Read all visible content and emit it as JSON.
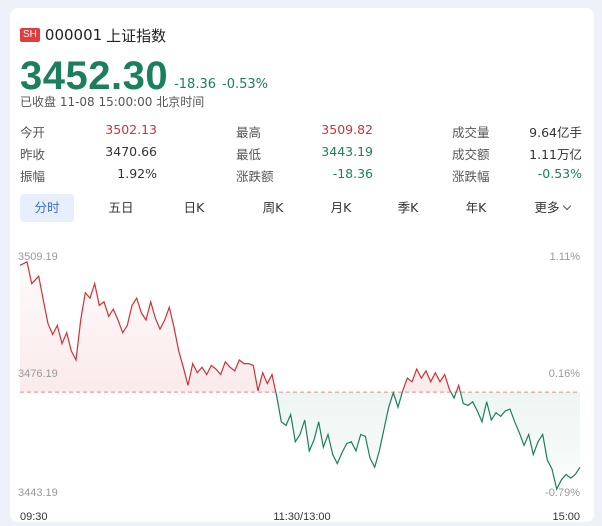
{
  "header": {
    "badge": "SH",
    "code": "000001",
    "name": "上证指数",
    "price": "3452.30",
    "change": "-18.36",
    "change_pct": "-0.53%",
    "status": "已收盘 11-08 15:00:00 北京时间"
  },
  "stats": [
    [
      {
        "label": "今开",
        "value": "3502.13",
        "tone": "red"
      },
      {
        "label": "最高",
        "value": "3509.82",
        "tone": "red"
      },
      {
        "label": "成交量",
        "value": "9.64亿手",
        "tone": "dark"
      }
    ],
    [
      {
        "label": "昨收",
        "value": "3470.66",
        "tone": "dark"
      },
      {
        "label": "最低",
        "value": "3443.19",
        "tone": "green"
      },
      {
        "label": "成交额",
        "value": "1.11万亿",
        "tone": "dark"
      }
    ],
    [
      {
        "label": "振幅",
        "value": "1.92%",
        "tone": "dark"
      },
      {
        "label": "涨跌额",
        "value": "-18.36",
        "tone": "green"
      },
      {
        "label": "涨跌幅",
        "value": "-0.53%",
        "tone": "green"
      }
    ]
  ],
  "tabs": [
    "分时",
    "五日",
    "日K",
    "周K",
    "月K",
    "季K",
    "年K",
    "更多"
  ],
  "active_tab": "分时",
  "colors": {
    "up": "#d0303a",
    "down": "#1b7f5b",
    "accent": "#3a6fd8",
    "prev_close_line": "#e88a8a"
  },
  "chart_data": {
    "type": "line",
    "y_left_ticks": [
      "3509.19",
      "3476.19",
      "3443.19"
    ],
    "y_right_ticks": [
      "1.11%",
      "0.16%",
      "-0.79%"
    ],
    "x_ticks": [
      "09:30",
      "11:30/13:00",
      "15:00"
    ],
    "ylim": [
      3443.19,
      3509.19
    ],
    "prev_close": 3470.66,
    "grid": false,
    "x": [
      0,
      3,
      5,
      8,
      10,
      12,
      14,
      16,
      18,
      20,
      22,
      24,
      26,
      28,
      30,
      32,
      34,
      36,
      38,
      40,
      42,
      44,
      46,
      48,
      50,
      52,
      54,
      56,
      58,
      60,
      62,
      64,
      66,
      68,
      70,
      72,
      74,
      76,
      78,
      80,
      82,
      84,
      86,
      88,
      90,
      92,
      94,
      96,
      98,
      100,
      102,
      104,
      106,
      108,
      110,
      112,
      114,
      116,
      118,
      120,
      122,
      124,
      126,
      128,
      130,
      132,
      134,
      136,
      138,
      140,
      142,
      144,
      146,
      148,
      150,
      152,
      154,
      156,
      158,
      160,
      162,
      164,
      166,
      168,
      170,
      172,
      174,
      176,
      178,
      180,
      182,
      184,
      186,
      188,
      190,
      192,
      194,
      196,
      198,
      200,
      202,
      204,
      206,
      208,
      210,
      212,
      214,
      216,
      218,
      220,
      222,
      224,
      226,
      228,
      230,
      232,
      234,
      236,
      238,
      240
    ],
    "values": [
      3505.5,
      3506.5,
      3500.5,
      3502.5,
      3496.0,
      3489.5,
      3486.5,
      3489.0,
      3484.0,
      3487.0,
      3482.0,
      3479.5,
      3490.5,
      3498.0,
      3496.5,
      3500.5,
      3494.5,
      3495.5,
      3491.5,
      3493.5,
      3490.5,
      3487.0,
      3489.0,
      3494.5,
      3496.5,
      3492.5,
      3490.5,
      3495.5,
      3491.0,
      3488.0,
      3490.5,
      3494.0,
      3488.5,
      3482.0,
      3477.5,
      3472.5,
      3478.5,
      3476.0,
      3477.5,
      3475.5,
      3478.0,
      3477.0,
      3475.5,
      3479.0,
      3477.5,
      3476.5,
      3479.5,
      3478.5,
      3478.5,
      3478.0,
      3471.0,
      3476.0,
      3473.0,
      3475.5,
      3469.5,
      3462.5,
      3461.5,
      3464.5,
      3457.0,
      3459.0,
      3463.0,
      3454.5,
      3457.5,
      3462.5,
      3455.5,
      3459.0,
      3453.5,
      3451.0,
      3454.0,
      3456.5,
      3457.0,
      3454.5,
      3459.0,
      3458.5,
      3452.5,
      3450.0,
      3454.5,
      3460.5,
      3466.5,
      3470.5,
      3466.5,
      3471.0,
      3474.5,
      3473.5,
      3477.0,
      3474.5,
      3476.5,
      3473.5,
      3476.0,
      3473.5,
      3475.5,
      3471.5,
      3469.0,
      3472.5,
      3467.5,
      3467.0,
      3468.0,
      3465.5,
      3462.5,
      3468.0,
      3463.0,
      3465.0,
      3464.0,
      3465.5,
      3466.0,
      3462.5,
      3459.5,
      3456.0,
      3459.0,
      3453.5,
      3457.0,
      3459.0,
      3452.0,
      3449.5,
      3444.0,
      3446.5,
      3448.0,
      3447.0,
      3448.0,
      3450.0,
      3452.5,
      3452.3
    ]
  }
}
